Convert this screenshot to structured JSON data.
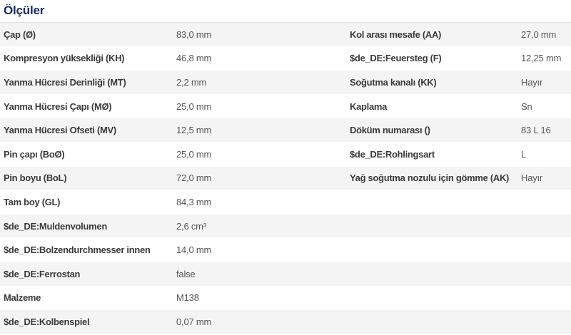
{
  "section": {
    "title": "Ölçüler"
  },
  "left_rows": [
    {
      "label": "Çap (Ø)",
      "value": "83,0 mm"
    },
    {
      "label": "Kompresyon yüksekliği (KH)",
      "value": "46,8 mm"
    },
    {
      "label": "Yanma Hücresi Derinliği (MT)",
      "value": "2,2 mm"
    },
    {
      "label": "Yanma Hücresi Çapı (MØ)",
      "value": "25,0 mm"
    },
    {
      "label": "Yanma Hücresi Ofseti (MV)",
      "value": "12,5 mm"
    },
    {
      "label": "Pin çapı (BoØ)",
      "value": "25,0 mm"
    },
    {
      "label": "Pin boyu (BoL)",
      "value": "72,0 mm"
    },
    {
      "label": "Tam boy (GL)",
      "value": "84,3 mm"
    },
    {
      "label": "$de_DE:Muldenvolumen",
      "value": "2,6 cm³"
    },
    {
      "label": "$de_DE:Bolzendurchmesser innen",
      "value": "14,0 mm"
    },
    {
      "label": "$de_DE:Ferrostan",
      "value": "false"
    },
    {
      "label": "Malzeme",
      "value": "M138"
    },
    {
      "label": "$de_DE:Kolbenspiel",
      "value": "0,07 mm"
    }
  ],
  "right_rows": [
    {
      "label": "Kol arası mesafe (AA)",
      "value": "27,0 mm"
    },
    {
      "label": "$de_DE:Feuersteg (F)",
      "value": "12,25 mm"
    },
    {
      "label": "Soğutma kanalı (KK)",
      "value": "Hayır"
    },
    {
      "label": "Kaplama",
      "value": "Sn"
    },
    {
      "label": "Döküm numarası ()",
      "value": "83 L 16"
    },
    {
      "label": "$de_DE:Rohlingsart",
      "value": "L"
    },
    {
      "label": "Yağ soğutma nozulu için gömme (AK)",
      "value": "Hayır"
    }
  ]
}
